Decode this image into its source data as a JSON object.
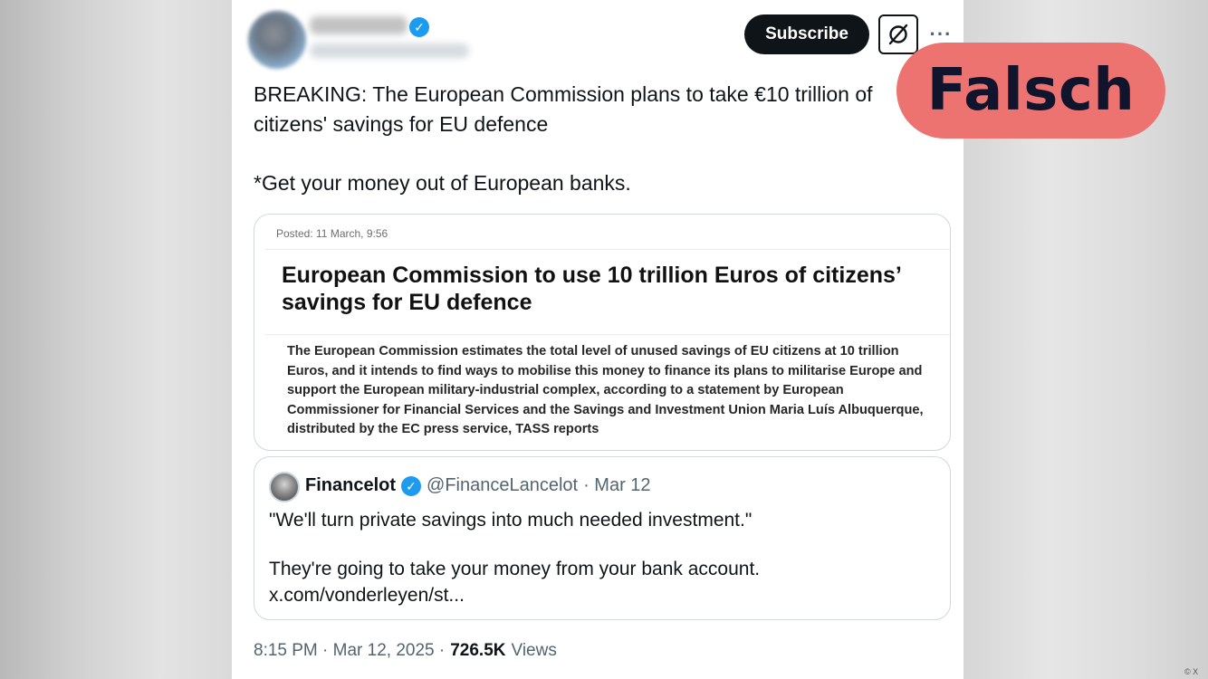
{
  "tweet": {
    "subscribe_label": "Subscribe",
    "more_label": "···",
    "text": [
      "BREAKING: The European Commission plans to take €10 trillion of citizens' savings for EU defence",
      "*Get your money out of European banks."
    ]
  },
  "card": {
    "posted": "Posted: 11 March, 9:56",
    "headline": "European Commission to use 10 trillion Euros of citizens’ savings for EU defence",
    "body": "The European Commission estimates the total level of unused savings of EU citizens at 10 trillion Euros, and it intends to find ways to mobilise this money to finance its plans to militarise Europe and support the European military-industrial complex, according to a statement by European Commissioner for Financial Services and the Savings and Investment Union Maria Luís Albuquerque, distributed by the EC press service, TASS reports"
  },
  "quote": {
    "name": "Financelot",
    "handle": "@FinanceLancelot",
    "date": "· Mar 12",
    "text": [
      "\"We'll turn private savings into much needed investment.\"",
      "They're going to take your money from your bank account.",
      "x.com/vonderleyen/st..."
    ]
  },
  "meta": {
    "time": "8:15 PM · Mar 12, 2025 ·",
    "views_count": "726.5K",
    "views_label": "Views"
  },
  "overlay": {
    "label": "Falsch",
    "credit": "© X"
  },
  "icons": {
    "verified": "verified-badge-icon",
    "grok": "grok-icon",
    "more": "more-options-icon"
  },
  "colors": {
    "verified_blue": "#1d9bf0",
    "subscribe_bg": "#0f1419",
    "falsch_bg": "#ec7370",
    "falsch_text": "#11142d",
    "secondary_text": "#536471"
  }
}
